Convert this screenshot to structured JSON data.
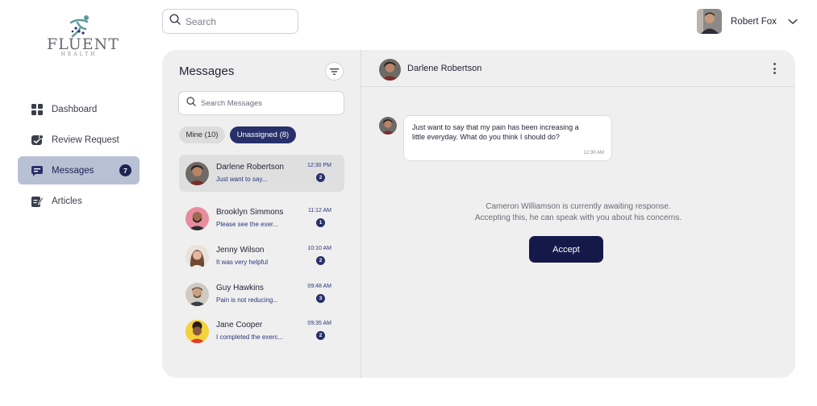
{
  "brand": {
    "name": "FLUENT",
    "tagline": "HEALTH"
  },
  "sidebar": {
    "items": [
      {
        "label": "Dashboard",
        "icon": "grid-icon"
      },
      {
        "label": "Review Request",
        "icon": "review-icon"
      },
      {
        "label": "Messages",
        "icon": "message-icon",
        "badge": "7",
        "active": true
      },
      {
        "label": "Articles",
        "icon": "article-edit-icon"
      }
    ]
  },
  "header": {
    "search_placeholder": "Search",
    "user_name": "Robert Fox"
  },
  "messages": {
    "title": "Messages",
    "search_placeholder": "Search Messages",
    "chips": {
      "mine": "Mine (10)",
      "unassigned": "Unassigned (8)"
    },
    "conversations": [
      {
        "name": "Darlene Robertson",
        "preview": "Just want to say...",
        "time": "12:30 PM",
        "unread": "2"
      },
      {
        "name": "Brooklyn Simmons",
        "preview": "Please see the exer...",
        "time": "11:12 AM",
        "unread": "1"
      },
      {
        "name": "Jenny Wilson",
        "preview": "It was very helpful",
        "time": "10:10 AM",
        "unread": "2"
      },
      {
        "name": "Guy Hawkins",
        "preview": "Pain is not reducing...",
        "time": "09:48 AM",
        "unread": "3"
      },
      {
        "name": "Jane Cooper",
        "preview": "I completed the exerc...",
        "time": "09:35 AM",
        "unread": "2"
      }
    ]
  },
  "chat": {
    "contact_name": "Darlene Robertson",
    "message_text": "Just want to say that my pain has been increasing a little everyday. What do you think I should do?",
    "message_time": "12:30 AM",
    "await_line1": "Cameron Williamson is currently awaiting response.",
    "await_line2": "Accepting this, he can speak with you about his concerns.",
    "accept_label": "Accept"
  },
  "colors": {
    "primary": "#15194a",
    "accent": "#27306a",
    "active_nav": "#b8c0d4",
    "panel": "#efefef"
  }
}
